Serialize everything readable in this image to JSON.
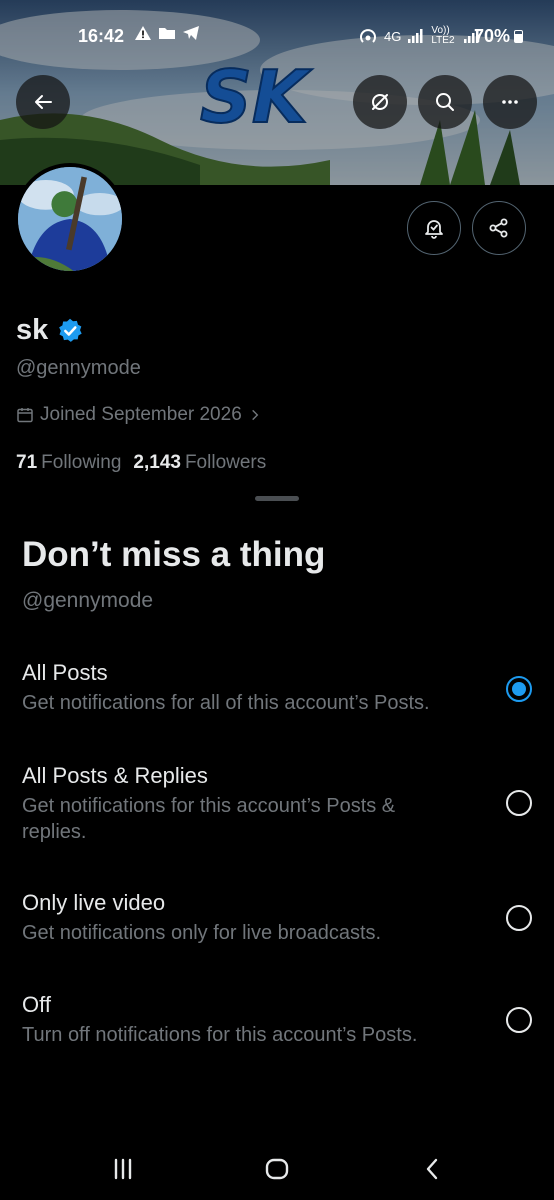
{
  "status_bar": {
    "time": "16:42",
    "left_icons": [
      "warning-icon",
      "folder-icon",
      "telegram-icon"
    ],
    "right_icons": [
      "hotspot-icon",
      "4g-icon",
      "signal-icon",
      "volte-icon",
      "signal-icon"
    ],
    "net_label": "4G",
    "volte_label": "Vo)) LTE2",
    "battery": "70%"
  },
  "banner": {
    "text": "SK",
    "colors": {
      "sky": "#6f93b8",
      "grass": "#2d4b2c",
      "logo": "#1d6fd6"
    }
  },
  "header_buttons": [
    "back-arrow-icon",
    "grok-icon",
    "search-icon",
    "more-icon"
  ],
  "profile": {
    "name": "sk",
    "handle": "@gennymode",
    "joined": "Joined September 2026",
    "following_count": "71",
    "following_label": "Following",
    "followers_count": "2,143",
    "followers_label": "Followers",
    "verified": true,
    "actions": [
      "bell-icon",
      "share-icon"
    ]
  },
  "sheet": {
    "title": "Don’t miss a thing",
    "subtitle": "@gennymode",
    "options": [
      {
        "label": "All Posts",
        "description": "Get notifications for all of this account’s Posts.",
        "selected": true
      },
      {
        "label": "All Posts & Replies",
        "description": "Get notifications for this account’s Posts & replies.",
        "selected": false
      },
      {
        "label": "Only live video",
        "description": "Get notifications only for live broadcasts.",
        "selected": false
      },
      {
        "label": "Off",
        "description": "Turn off notifications for this account’s Posts.",
        "selected": false
      }
    ]
  },
  "navbar": [
    "recents-icon",
    "home-icon",
    "back-icon"
  ],
  "colors": {
    "accent": "#1d9bf0",
    "muted": "#71767b",
    "text": "#e7e9ea",
    "background": "#000000",
    "border": "#536471"
  }
}
